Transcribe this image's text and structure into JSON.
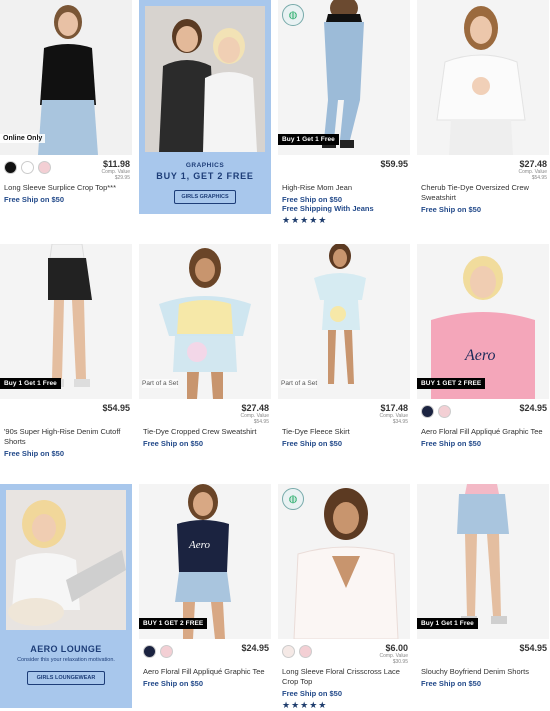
{
  "products": [
    {
      "name": "Long Sleeve Surplice Crop Top***",
      "price": "$11.98",
      "comp_label": "Comp. Value",
      "comp_value": "$29.95",
      "ship": "Free Ship on $50",
      "badge": "",
      "tag": "Online Only",
      "swatches": [
        "#111111",
        "#ffffff",
        "#f3cfd4"
      ]
    },
    {
      "name": "High-Rise Mom Jean",
      "price": "$59.95",
      "ship": "Free Ship on $50",
      "ship2": "Free Shipping With Jeans",
      "badge": "Buy 1 Get 1 Free",
      "stars": "★★★★★",
      "earth": true
    },
    {
      "name": "Cherub Tie-Dye Oversized Crew Sweatshirt",
      "price": "$27.48",
      "comp_label": "Comp. Value",
      "comp_value": "$54.95",
      "ship": "Free Ship on $50"
    },
    {
      "name": "'90s Super High-Rise Denim Cutoff Shorts",
      "price": "$54.95",
      "ship": "Free Ship on $50",
      "badge": "Buy 1 Get 1 Free"
    },
    {
      "name": "Tie-Dye Cropped Crew Sweatshirt",
      "price": "$27.48",
      "comp_label": "Comp. Value",
      "comp_value": "$54.95",
      "ship": "Free Ship on $50",
      "tag": "Part of a Set"
    },
    {
      "name": "Tie-Dye Fleece Skirt",
      "price": "$17.48",
      "comp_label": "Comp. Value",
      "comp_value": "$34.95",
      "ship": "Free Ship on $50",
      "tag": "Part of a Set"
    },
    {
      "name": "Aero Floral Fill Appliqué Graphic Tee",
      "price": "$24.95",
      "ship": "Free Ship on $50",
      "badge": "BUY 1 GET 2 FREE",
      "swatches": [
        "#1b2340",
        "#f3cfd4"
      ]
    },
    {
      "name": "Aero Floral Fill Appliqué Graphic Tee",
      "price": "$24.95",
      "ship": "Free Ship on $50",
      "badge": "BUY 1 GET 2 FREE",
      "swatches": [
        "#1b2340",
        "#f3cfd4"
      ]
    },
    {
      "name": "Long Sleeve Floral Crisscross Lace Crop Top",
      "price": "$6.00",
      "comp_label": "Comp. Value",
      "comp_value": "$30.95",
      "ship": "Free Ship on $50",
      "stars": "★★★★★",
      "earth": true,
      "swatches": [
        "#f5e9e6",
        "#f3cfd4"
      ]
    },
    {
      "name": "Slouchy Boyfriend Denim Shorts",
      "price": "$54.95",
      "ship": "Free Ship on $50",
      "badge": "Buy 1 Get 1 Free"
    }
  ],
  "promos": [
    {
      "kicker": "GRAPHICS",
      "title": "BUY 1, GET 2 FREE",
      "button": "GIRLS GRAPHICS"
    },
    {
      "title": "AERO LOUNGE",
      "subtitle": "Consider this your relaxation motivation.",
      "button": "GIRLS LOUNGEWEAR"
    }
  ],
  "colors": {
    "accent_blue": "#234a8a",
    "promo_bg": "#a8c7ec",
    "promo_text": "#1d3d78"
  }
}
